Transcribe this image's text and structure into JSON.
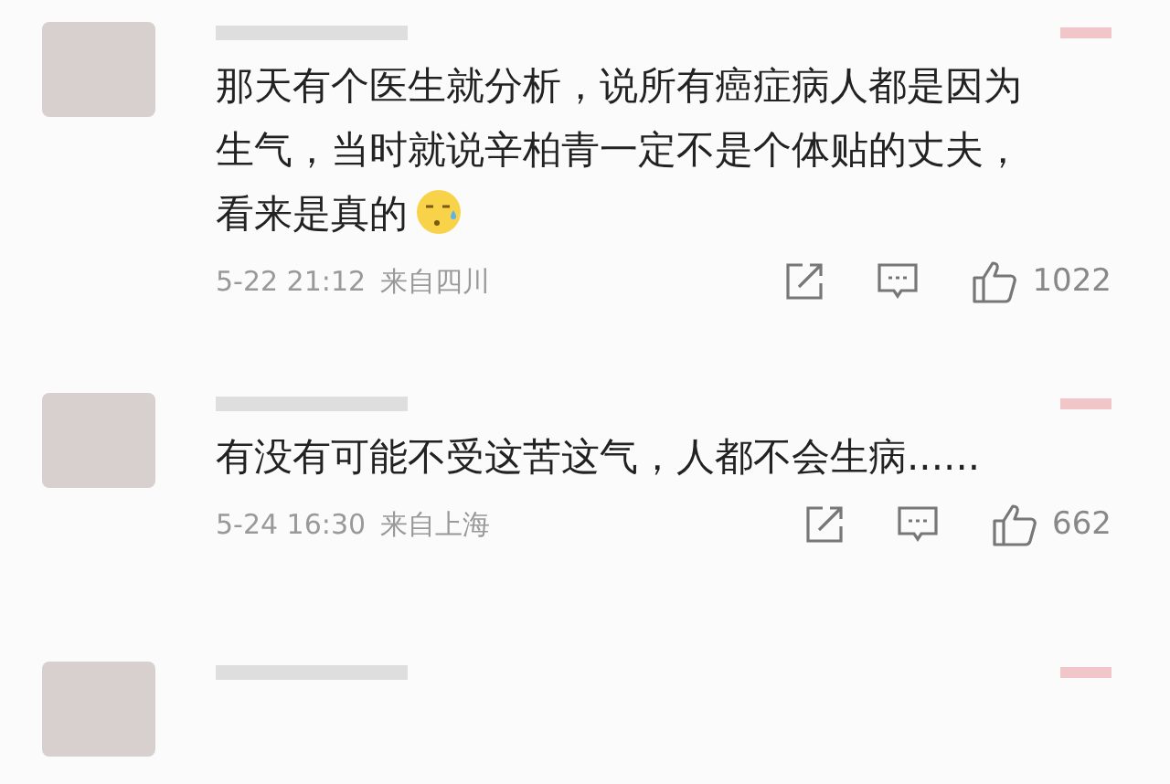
{
  "comments": [
    {
      "kind": "full",
      "text": "那天有个医生就分析，说所有癌症病人都是因为生气，当时就说辛柏青一定不是个体贴的丈夫，看来是真的",
      "emoji": true,
      "time": "5-22 21:12",
      "source": "来自四川",
      "likes": "1022"
    },
    {
      "kind": "full",
      "text": "有没有可能不受这苦这气，人都不会生病......",
      "emoji": false,
      "time": "5-24 16:30",
      "source": "来自上海",
      "likes": "662"
    },
    {
      "kind": "partial"
    }
  ]
}
